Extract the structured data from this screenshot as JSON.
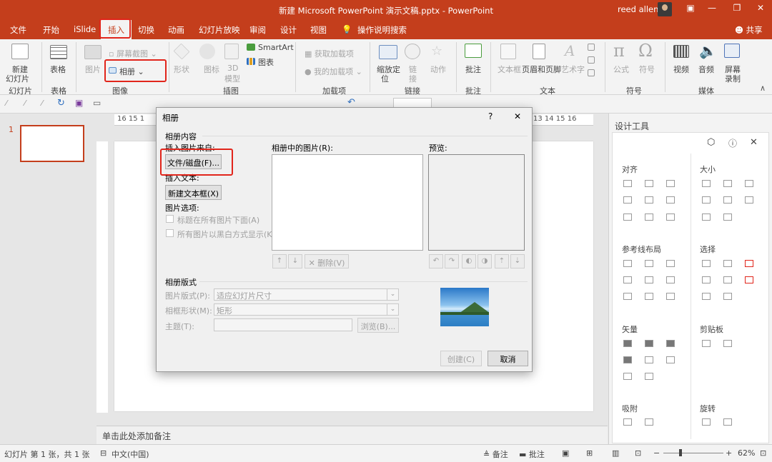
{
  "titlebar": {
    "title": "新建 Microsoft PowerPoint 演示文稿.pptx - PowerPoint",
    "user": "reed allen",
    "share": "共享",
    "tell_me": "操作说明搜索"
  },
  "tabs": [
    "文件",
    "开始",
    "iSlide",
    "插入",
    "切换",
    "动画",
    "幻灯片放映",
    "审阅",
    "设计",
    "视图"
  ],
  "active_tab": "插入",
  "ribbon": {
    "new_slide": "新建\n幻灯片",
    "new_slide_top": "新建",
    "new_slide_bottom": "幻灯片",
    "table": "表格",
    "picture": "图片",
    "screenshot": "屏幕截图",
    "album": "相册",
    "shape": "形状",
    "icon": "图标",
    "model3d_a": "3D",
    "model3d_b": "模型",
    "smartart": "SmartArt",
    "chart": "图表",
    "get_addins": "获取加载项",
    "my_addins": "我的加载项",
    "zoom_a": "缩放定",
    "zoom_b": "位",
    "link_a": "链",
    "link_b": "接",
    "action": "动作",
    "comment": "批注",
    "textbox": "文本框",
    "header_footer": "页眉和页脚",
    "wordart": "艺术字",
    "equation": "公式",
    "symbol": "符号",
    "video": "视频",
    "audio": "音频",
    "screen_rec_a": "屏幕",
    "screen_rec_b": "录制",
    "groups": {
      "slides": "幻灯片",
      "tables": "表格",
      "images": "图像",
      "illustrations": "插图",
      "addins": "加载项",
      "links": "链接",
      "comments": "批注",
      "text": "文本",
      "symbols": "符号",
      "media": "媒体"
    }
  },
  "slide_panel": {
    "number": "1"
  },
  "ruler_top": "16 15 1",
  "ruler_top_right": "13 14 15 16",
  "notes_placeholder": "单击此处添加备注",
  "right_pane": {
    "title": "设计工具",
    "sections": {
      "align": "对齐",
      "size": "大小",
      "guides": "参考线布局",
      "select": "选择",
      "vector": "矢量",
      "clipboard": "剪贴板",
      "snap": "吸附",
      "rotate": "旋转"
    }
  },
  "status": {
    "slide_info": "幻灯片 第 1 张，共 1 张",
    "language": "中文(中国)",
    "notes": "备注",
    "comments": "批注",
    "zoom": "62%"
  },
  "dialog": {
    "title": "相册",
    "help": "?",
    "close": "✕",
    "album_content": "相册内容",
    "insert_from": "插入图片来自:",
    "file_disk": "文件/磁盘(F)...",
    "insert_text": "插入文本:",
    "new_textbox": "新建文本框(X)",
    "picture_options": "图片选项:",
    "captions_below": "标题在所有图片下面(A)",
    "black_white": "所有图片以黑白方式显示(K)",
    "pictures_in_album": "相册中的图片(R):",
    "preview": "预览:",
    "delete": "删除(V)",
    "album_layout": "相册版式",
    "picture_layout_label": "图片版式(P):",
    "picture_layout_value": "适应幻灯片尺寸",
    "frame_shape_label": "相框形状(M):",
    "frame_shape_value": "矩形",
    "theme_label": "主题(T):",
    "browse": "浏览(B)...",
    "create": "创建(C)",
    "cancel": "取消"
  }
}
